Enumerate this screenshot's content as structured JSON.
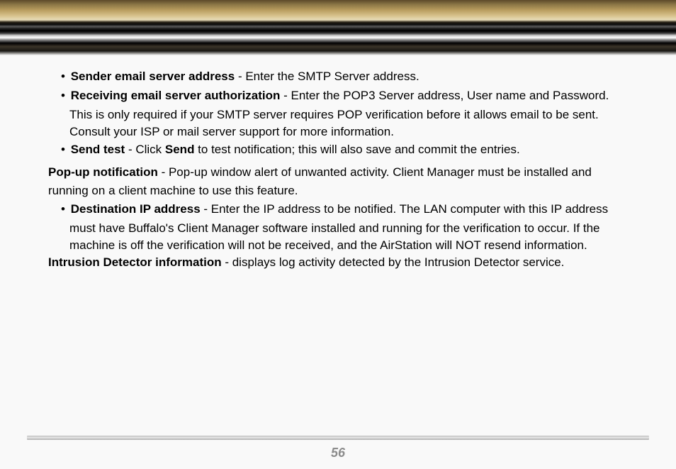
{
  "item1": {
    "title": "Sender email server address",
    "desc": " - Enter the SMTP Server address."
  },
  "item2": {
    "title": "Receiving email server authorization",
    "desc": " - Enter the POP3 Server address, User name and Password.",
    "cont1": "This is only required if your SMTP server requires POP verification before it allows email to be sent.",
    "cont2": "Consult your ISP or mail server support for more information."
  },
  "item3": {
    "title": "Send test",
    "sep": " - Click ",
    "action": "Send",
    "rest": " to test notification; this will also save and commit the entries."
  },
  "popup": {
    "title": "Pop-up notification",
    "line1": " - Pop-up window alert of unwanted activity. Client Manager must be installed and",
    "line2": "running on a client machine to use this feature."
  },
  "dest": {
    "title": "Destination IP address",
    "line1": " - Enter the IP address to be notified.  The LAN computer with this IP address",
    "line2": "must have Buffalo's Client Manager software installed and running for the verification to occur.  If the",
    "line3": "machine is off the verification will not be received, and the AirStation will NOT resend information."
  },
  "intrusion": {
    "title": "Intrusion Detector information",
    "desc": " - displays log activity detected by the Intrusion Detector service."
  },
  "page_number": "56"
}
